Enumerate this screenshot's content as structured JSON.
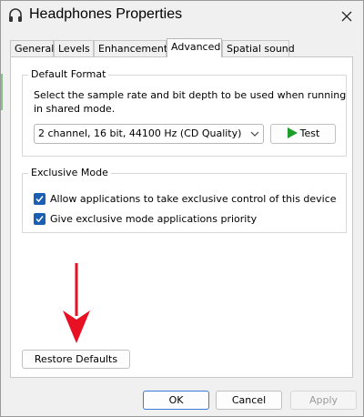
{
  "window": {
    "title": "Headphones Properties",
    "icon": "headphones-icon",
    "close_icon": "close-icon"
  },
  "tabs": [
    {
      "label": "General",
      "active": false
    },
    {
      "label": "Levels",
      "active": false
    },
    {
      "label": "Enhancements",
      "active": false
    },
    {
      "label": "Advanced",
      "active": true
    },
    {
      "label": "Spatial sound",
      "active": false
    }
  ],
  "default_format": {
    "heading": "Default Format",
    "description": "Select the sample rate and bit depth to be used when running in shared mode.",
    "selected_format": "2 channel, 16 bit, 44100 Hz (CD Quality)",
    "test_label": "Test",
    "test_icon": "play-icon"
  },
  "exclusive_mode": {
    "heading": "Exclusive Mode",
    "options": [
      {
        "label": "Allow applications to take exclusive control of this device",
        "checked": true
      },
      {
        "label": "Give exclusive mode applications priority",
        "checked": true
      }
    ]
  },
  "annotation": {
    "icon": "red-arrow-icon",
    "color": "#e81123"
  },
  "restore_defaults_label": "Restore Defaults",
  "footer": {
    "ok_label": "OK",
    "cancel_label": "Cancel",
    "apply_label": "Apply"
  },
  "colors": {
    "accent": "#1a5fb4",
    "play_green": "#1f9d2a",
    "arrow_red": "#e81123"
  }
}
